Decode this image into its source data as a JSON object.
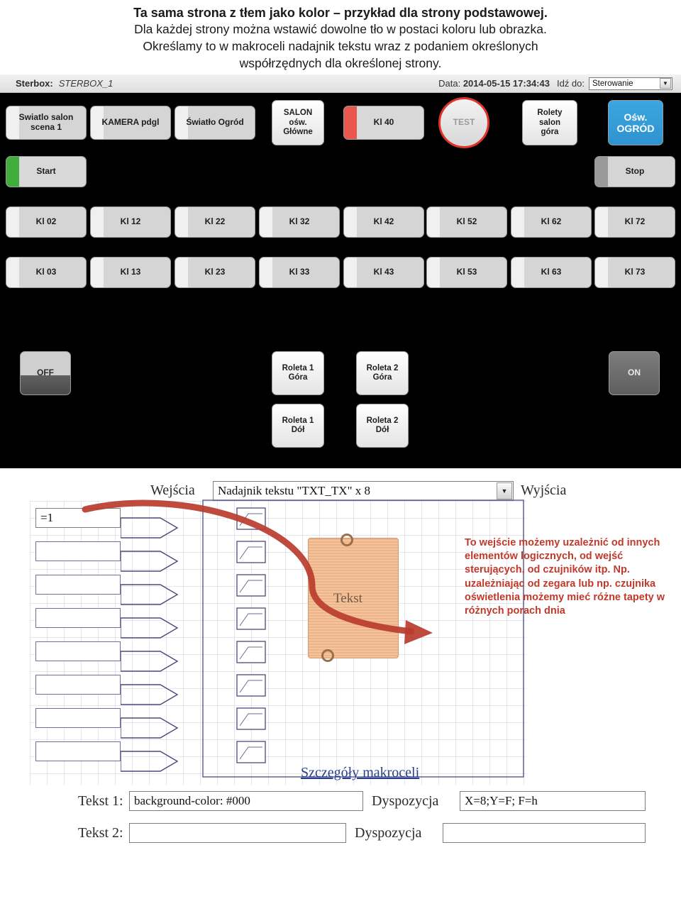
{
  "intro": {
    "lines": [
      {
        "text": "Ta sama strona z tłem jako kolor – przykład dla strony podstawowej.",
        "bold": true
      },
      {
        "text": "Dla każdej strony można wstawić dowolne tło w postaci koloru lub obrazka.",
        "bold": false
      },
      {
        "text": "Określamy to w makroceli nadajnik tekstu wraz z podaniem określonych",
        "bold": false
      },
      {
        "text": "współrzędnych dla określonej strony.",
        "bold": false
      }
    ]
  },
  "panel": {
    "titlebar": {
      "label": "Sterbox:",
      "device": "STERBOX_1",
      "date_label": "Data:",
      "date_value": "2014-05-15 17:34:43",
      "goto_label": "Idź do:",
      "page_select": "Sterowanie"
    },
    "row1": [
      {
        "label": "Swiatlo salon\nscena 1",
        "style": "split-left-grey"
      },
      {
        "label": "KAMERA pdgl",
        "style": "split-left-grey"
      },
      {
        "label": "Światło Ogród",
        "style": "split-left-grey"
      },
      {
        "label": "SALON\nośw.\nGłówne",
        "style": "light"
      },
      {
        "label": "Kl 40",
        "style": "split-red"
      },
      {
        "label": "TEST",
        "style": "round"
      },
      {
        "label": "Rolety\nsalon\ngóra",
        "style": "light"
      },
      {
        "label": "Ośw.\nOGRÓD",
        "style": "blue"
      }
    ],
    "row2": [
      {
        "label": "Start",
        "style": "split-green"
      },
      {
        "label": "Stop",
        "style": "split-left-grey"
      }
    ],
    "row3": [
      "Kl 02",
      "Kl 12",
      "Kl 22",
      "Kl 32",
      "Kl 42",
      "Kl 52",
      "Kl 62",
      "Kl 72"
    ],
    "row4": [
      "Kl 03",
      "Kl 13",
      "Kl 23",
      "Kl 33",
      "Kl 43",
      "Kl 53",
      "Kl 63",
      "Kl 73"
    ],
    "row5": [
      {
        "label": "OFF",
        "style": "offbtn"
      },
      {
        "label": "Roleta 1\nGóra",
        "style": "light"
      },
      {
        "label": "Roleta 2\nGóra",
        "style": "light"
      },
      {
        "label": "ON",
        "style": "dark"
      }
    ],
    "row6": [
      {
        "label": "Roleta 1\nDół",
        "style": "light"
      },
      {
        "label": "Roleta 2\nDół",
        "style": "light"
      }
    ]
  },
  "editor": {
    "inputs_label": "Wejścia",
    "outputs_label": "Wyjścia",
    "macro_select": "Nadajnik tekstu \"TXT_TX\" x 8",
    "first_input_value": "=1",
    "paper_text": "Tekst",
    "details_link": "Szczegóły makroceli",
    "text1_label": "Tekst 1:",
    "text1_value": "background-color: #000",
    "text2_label": "Tekst 2:",
    "text2_value": "",
    "disposition1_label": "Dyspozycja",
    "disposition1_value": "X=8;Y=F; F=h",
    "disposition2_label": "Dyspozycja",
    "disposition2_value": ""
  },
  "annotation": {
    "text": "To wejście możemy uzależnić od innych elementów logicznych, od wejść sterujących, od czujników itp. Np. uzależniając od zegara lub np. czujnika oświetlenia możemy mieć różne tapety w różnych porach dnia",
    "color": "#c0392b"
  }
}
